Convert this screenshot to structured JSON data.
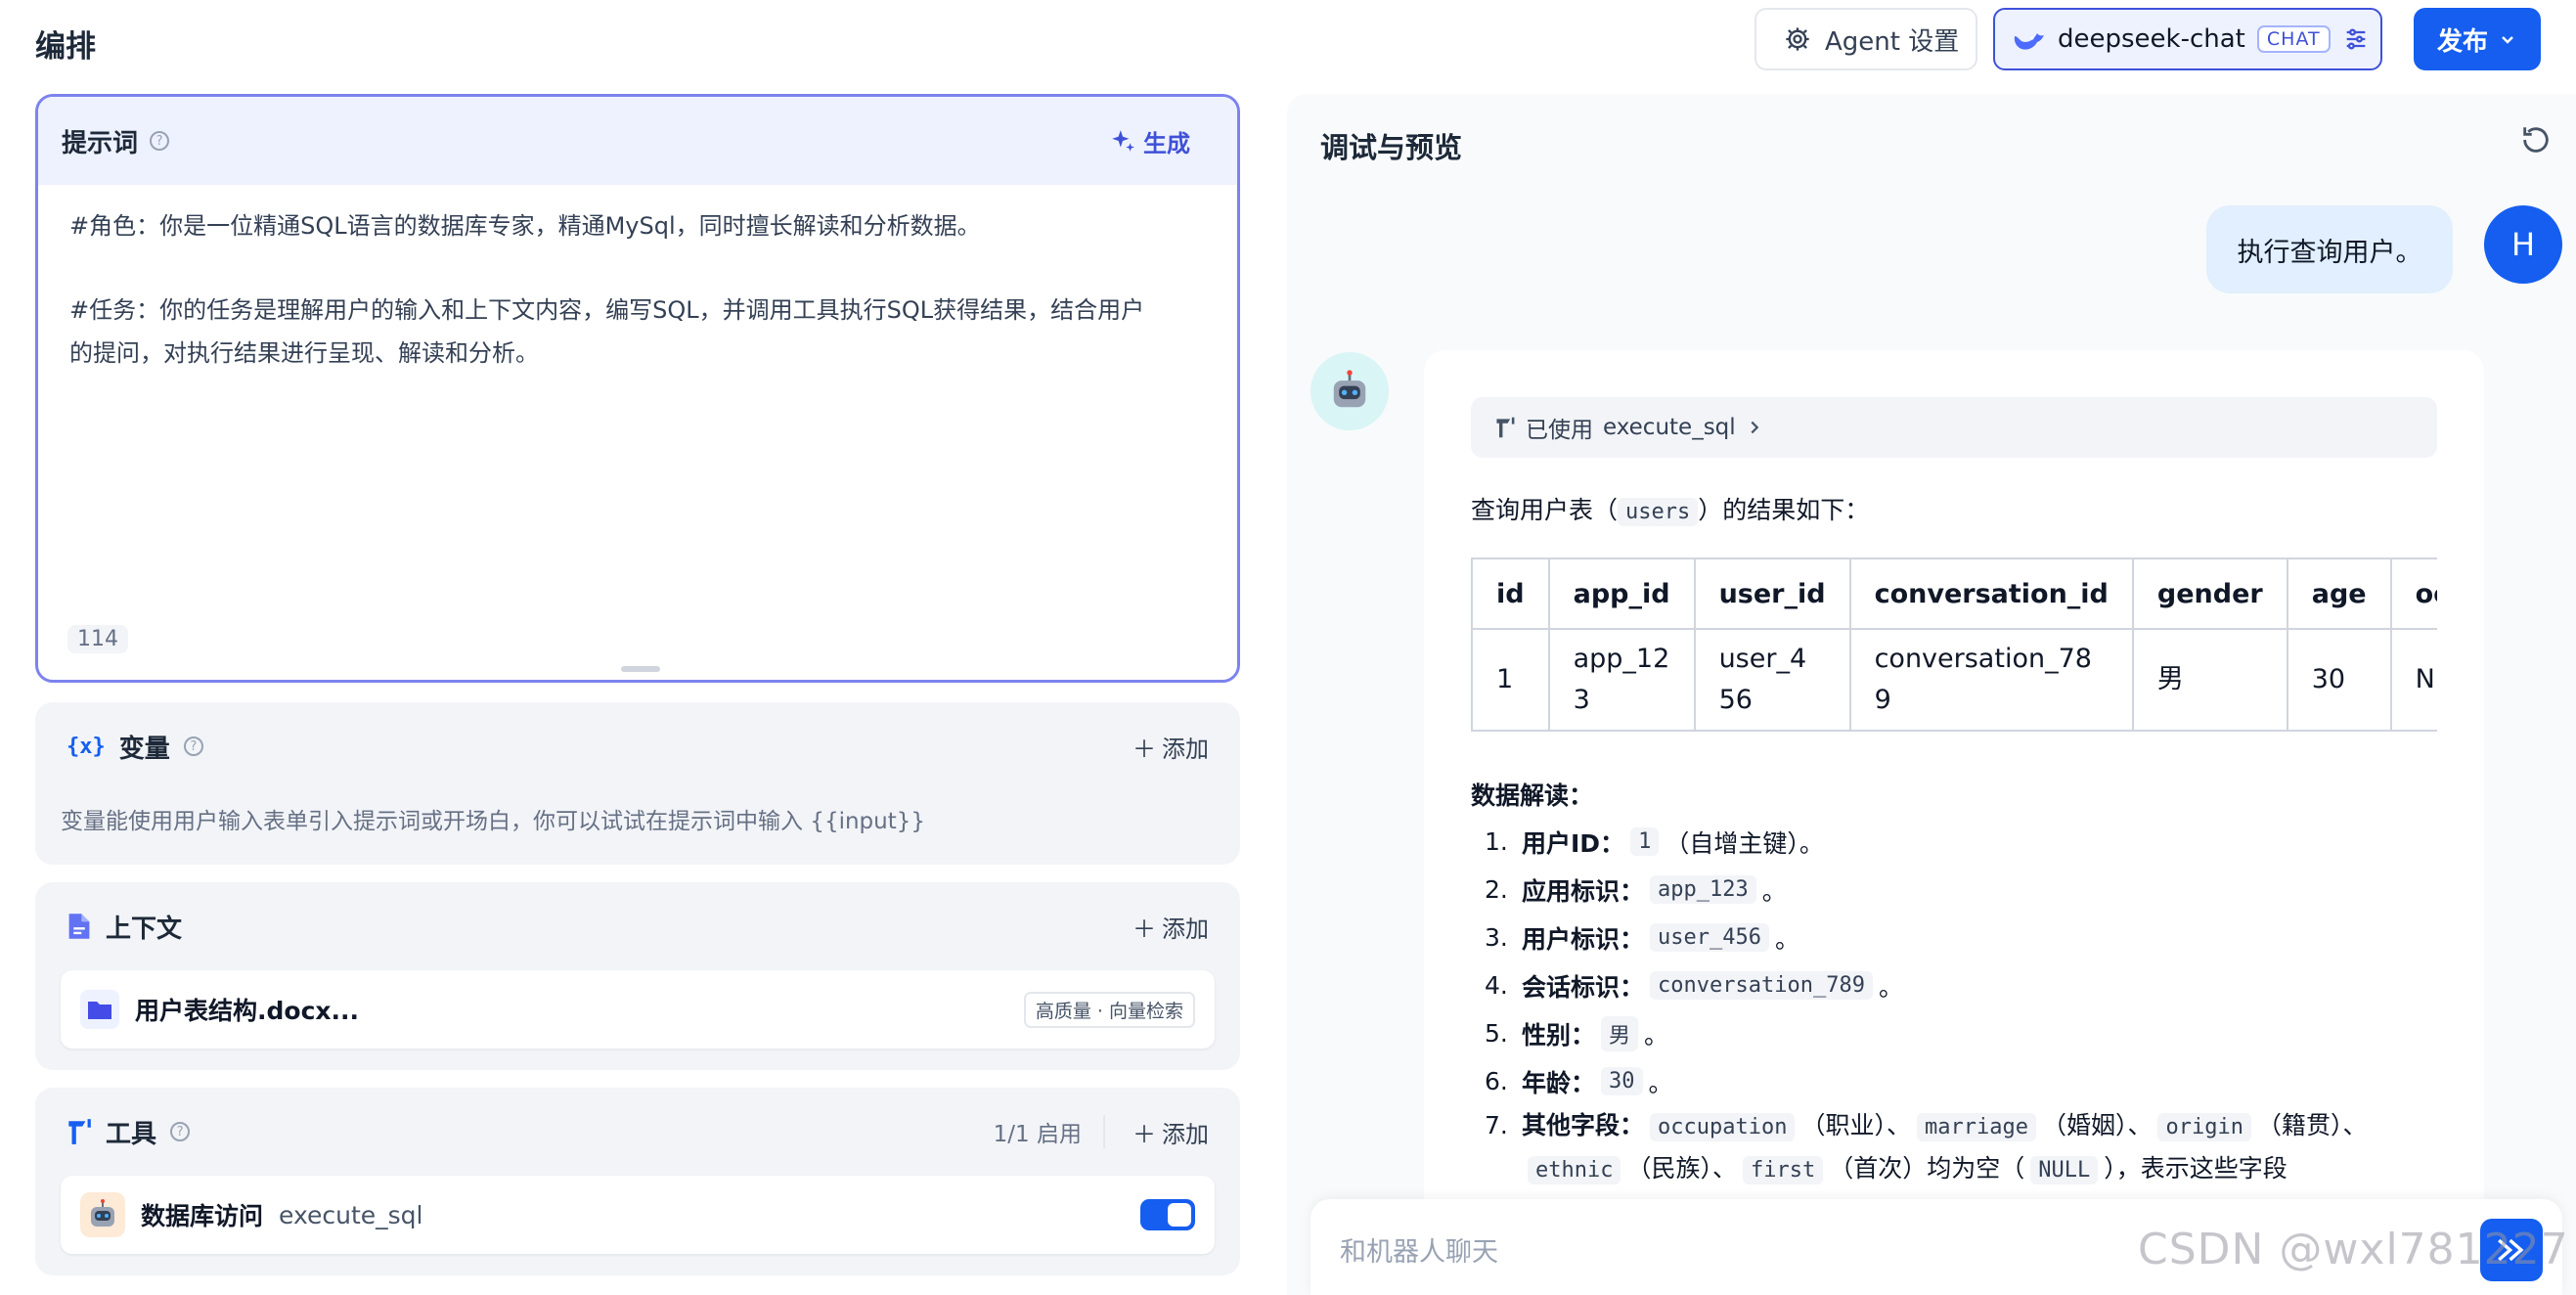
{
  "header": {
    "title": "编排",
    "agent_settings_label": "Agent 设置",
    "model_name": "deepseek-chat",
    "model_badge": "CHAT",
    "publish_label": "发布"
  },
  "prompt": {
    "title": "提示词",
    "help": "?",
    "generate_label": "生成",
    "line1": "#角色：你是一位精通SQL语言的数据库专家，精通MySql，同时擅长解读和分析数据。",
    "line2": "#任务：你的任务是理解用户的输入和上下文内容，编写SQL，并调用工具执行SQL获得结果，结合用户",
    "line3": "的提问，对执行结果进行呈现、解读和分析。",
    "char_count": "114"
  },
  "variables": {
    "icon_text": "{x}",
    "title": "变量",
    "help": "?",
    "add_label": "添加",
    "description": "变量能使用用户输入表单引入提示词或开场白，你可以试试在提示词中输入 {{input}}"
  },
  "context": {
    "title": "上下文",
    "add_label": "添加",
    "file_name": "用户表结构.docx...",
    "file_tag": "高质量 · 向量检索"
  },
  "tools": {
    "title": "工具",
    "help": "?",
    "enabled_count": "1/1 启用",
    "add_label": "添加",
    "tool_name": "数据库访问",
    "tool_id": "execute_sql",
    "enabled": true
  },
  "preview": {
    "title": "调试与预览",
    "user_message": "执行查询用户。",
    "user_avatar": "H",
    "tool_used_prefix": "已使用",
    "tool_used_name": "execute_sql",
    "result_prefix": "查询用户表（",
    "result_table": "users",
    "result_suffix": "）的结果如下：",
    "table": {
      "headers": [
        "id",
        "app_id",
        "user_id",
        "conversation_id",
        "gender",
        "age",
        "occu"
      ],
      "rows": [
        [
          "1",
          "app_12\n3",
          "user_4\n56",
          "conversation_78\n9",
          "男",
          "30",
          "NULI"
        ]
      ]
    },
    "interp_title": "数据解读：",
    "items": [
      {
        "num": "1.",
        "label": "用户ID：",
        "code": "1",
        "after": "（自增主键）。"
      },
      {
        "num": "2.",
        "label": "应用标识：",
        "code": "app_123",
        "after": "。"
      },
      {
        "num": "3.",
        "label": "用户标识：",
        "code": "user_456",
        "after": "。"
      },
      {
        "num": "4.",
        "label": "会话标识：",
        "code": "conversation_789",
        "after": "。"
      },
      {
        "num": "5.",
        "label": "性别：",
        "code": "男",
        "after": "。"
      },
      {
        "num": "6.",
        "label": "年龄：",
        "code": "30",
        "after": "。"
      }
    ],
    "item7": {
      "num": "7.",
      "label": "其他字段：",
      "c1": "occupation",
      "t1": "（职业）、",
      "c2": "marriage",
      "t2": "（婚姻）、",
      "c3": "origin",
      "t3": "（籍贯）、",
      "c4": "ethnic",
      "t4": "（民族）、",
      "c5": "first",
      "t5": "（首次）均为空（",
      "c6": "NULL",
      "t6": "），表示这些字段"
    },
    "input_placeholder": "和机器人聊天"
  },
  "watermark": "CSDN @wxl781227",
  "colors": {
    "accent": "#155eef",
    "prompt_border": "#7c83ee",
    "section_bg": "#f2f4f7"
  }
}
